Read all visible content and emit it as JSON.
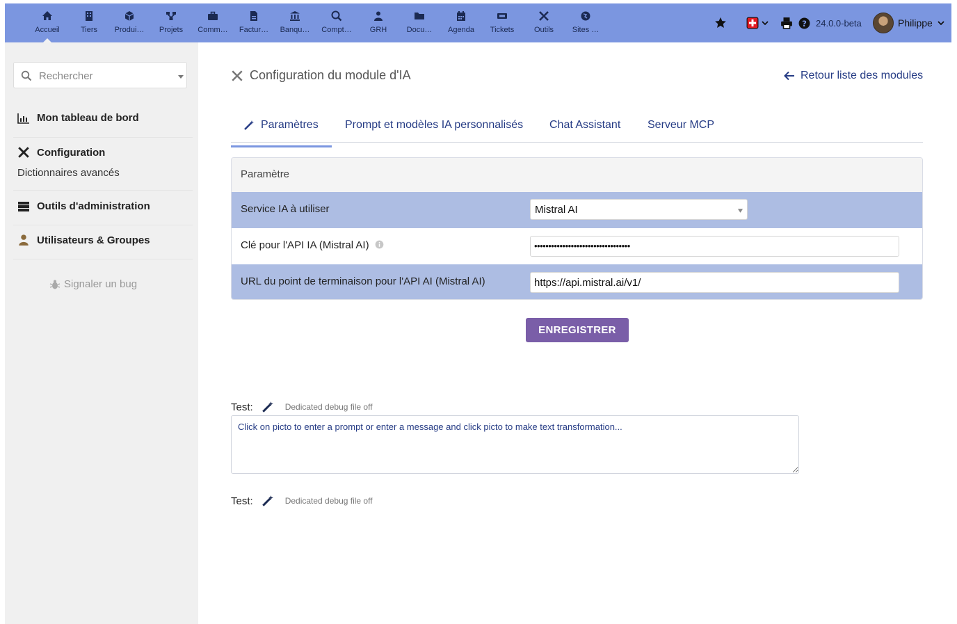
{
  "topbar": {
    "menu": [
      {
        "label": "Accueil",
        "icon": "home-icon"
      },
      {
        "label": "Tiers",
        "icon": "building-icon"
      },
      {
        "label": "Produi…",
        "icon": "cube-icon"
      },
      {
        "label": "Projets",
        "icon": "sitemap-icon"
      },
      {
        "label": "Comm…",
        "icon": "briefcase-icon"
      },
      {
        "label": "Factur…",
        "icon": "invoice-icon"
      },
      {
        "label": "Banqu…",
        "icon": "bank-icon"
      },
      {
        "label": "Compt…",
        "icon": "search-dollar-icon"
      },
      {
        "label": "GRH",
        "icon": "users-icon"
      },
      {
        "label": "Docu…",
        "icon": "folder-icon"
      },
      {
        "label": "Agenda",
        "icon": "calendar-icon"
      },
      {
        "label": "Tickets",
        "icon": "ticket-icon"
      },
      {
        "label": "Outils",
        "icon": "tools-icon"
      },
      {
        "label": "Sites …",
        "icon": "globe-icon"
      }
    ],
    "version": "24.0.0-beta",
    "user_name": "Philippe"
  },
  "sidebar": {
    "search_placeholder": "Rechercher",
    "items": [
      {
        "label": "Mon tableau de bord",
        "icon": "dashboard-icon"
      },
      {
        "label": "Configuration",
        "icon": "tools-icon",
        "sub": "Dictionnaires avancés"
      },
      {
        "label": "Outils d'administration",
        "icon": "server-icon"
      },
      {
        "label": "Utilisateurs & Groupes",
        "icon": "user-icon"
      }
    ],
    "bug_label": "Signaler un bug"
  },
  "page": {
    "title": "Configuration du module d'IA",
    "back_label": "Retour liste des modules"
  },
  "tabs": [
    {
      "label": "Paramètres",
      "active": true
    },
    {
      "label": "Prompt et modèles IA personnalisés",
      "active": false
    },
    {
      "label": "Chat Assistant",
      "active": false
    },
    {
      "label": "Serveur MCP",
      "active": false
    }
  ],
  "params": {
    "header": "Paramètre",
    "rows": [
      {
        "label": "Service IA à utiliser",
        "value": "Mistral AI",
        "type": "select"
      },
      {
        "label": "Clé pour l'API IA (Mistral AI)",
        "value": "••••••••••••••••••••••••••••••••••",
        "type": "password"
      },
      {
        "label": "URL du point de terminaison pour l'API AI (Mistral AI)",
        "value": "https://api.mistral.ai/v1/",
        "type": "text"
      }
    ]
  },
  "save_label": "ENREGISTRER",
  "tests": [
    {
      "label": "Test:",
      "debug": "Dedicated debug file off",
      "placeholder": "Click on picto to enter a prompt or enter a message and click picto to make text transformation..."
    },
    {
      "label": "Test:",
      "debug": "Dedicated debug file off"
    }
  ],
  "colors": {
    "topbar": "#7b96e0",
    "sidebar": "#f0f0f0",
    "row_highlight": "#adbde3",
    "header_row": "#f4f4f4",
    "link": "#263c85",
    "button": "#7a5ea8",
    "tab_underline": "#7b96e0"
  }
}
